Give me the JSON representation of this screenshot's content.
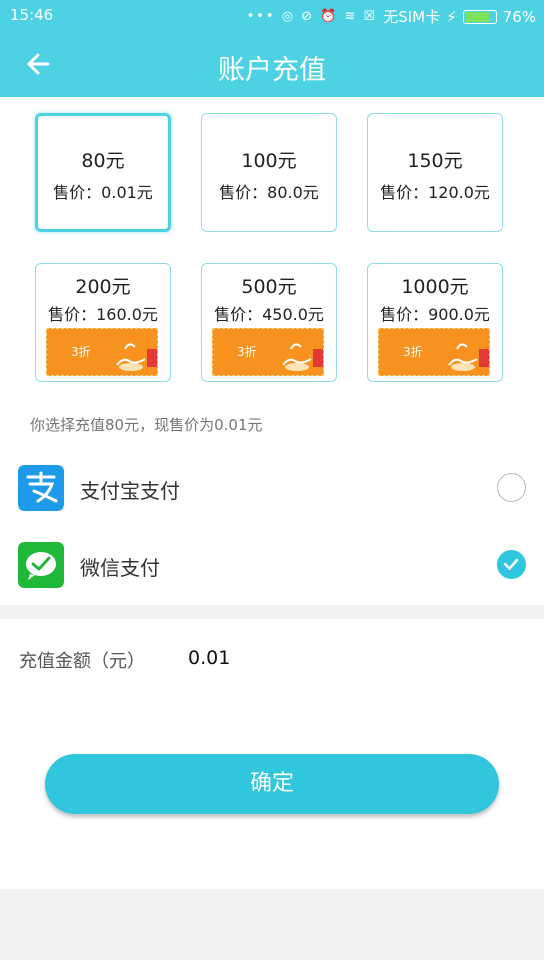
{
  "status_bar": {
    "time": "15:46",
    "carrier": "无SIM卡",
    "battery": "76%",
    "icons": [
      "more-dots-icon",
      "sync-icon",
      "vibrate-icon",
      "alarm-icon",
      "wifi-icon",
      "no-sim-icon",
      "charging-icon",
      "battery-icon"
    ]
  },
  "header": {
    "title": "账户充值",
    "back_icon": "arrow-left-icon",
    "color": "#4dd2e4"
  },
  "options": [
    {
      "amount": "80元",
      "price": "售价：0.01元",
      "selected": true,
      "promo": null
    },
    {
      "amount": "100元",
      "price": "售价：80.0元",
      "selected": false,
      "promo": null
    },
    {
      "amount": "150元",
      "price": "售价：120.0元",
      "selected": false,
      "promo": null
    },
    {
      "amount": "200元",
      "price": "售价：160.0元",
      "selected": false,
      "promo": "3折"
    },
    {
      "amount": "500元",
      "price": "售价：450.0元",
      "selected": false,
      "promo": "3折"
    },
    {
      "amount": "1000元",
      "price": "售价：900.0元",
      "selected": false,
      "promo": "3折"
    }
  ],
  "selection_note": "你选择充值80元，现售价为0.01元",
  "payment_methods": [
    {
      "label": "支付宝支付",
      "icon": "alipay-icon",
      "checked": false
    },
    {
      "label": "微信支付",
      "icon": "wechat-icon",
      "checked": true
    }
  ],
  "amount": {
    "label": "充值金额（元）",
    "value": "0.01"
  },
  "confirm_label": "确定",
  "colors": {
    "accent": "#30c6dd",
    "promo": "#f7921e",
    "alipay": "#1e9be8",
    "wechat": "#20b838"
  }
}
